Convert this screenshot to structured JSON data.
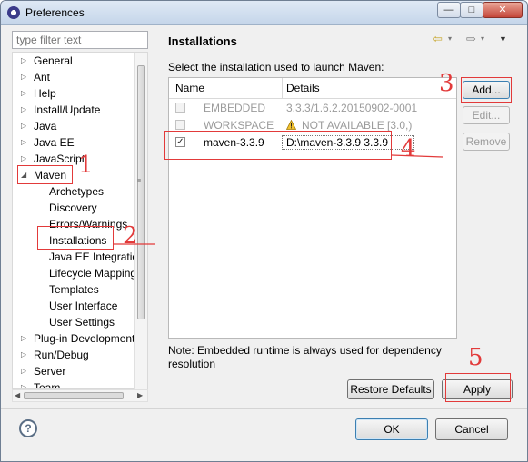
{
  "window": {
    "title": "Preferences",
    "minimize_glyph": "—",
    "maximize_glyph": "□",
    "close_glyph": "✕"
  },
  "sidebar": {
    "filter_placeholder": "type filter text",
    "items": [
      {
        "label": "General",
        "expander": "▷"
      },
      {
        "label": "Ant",
        "expander": "▷"
      },
      {
        "label": "Help",
        "expander": "▷"
      },
      {
        "label": "Install/Update",
        "expander": "▷"
      },
      {
        "label": "Java",
        "expander": "▷"
      },
      {
        "label": "Java EE",
        "expander": "▷"
      },
      {
        "label": "JavaScript",
        "expander": "▷"
      },
      {
        "label": "Maven",
        "expander": "◢"
      },
      {
        "label": "Archetypes"
      },
      {
        "label": "Discovery"
      },
      {
        "label": "Errors/Warnings"
      },
      {
        "label": "Installations"
      },
      {
        "label": "Java EE Integration"
      },
      {
        "label": "Lifecycle Mapping"
      },
      {
        "label": "Templates"
      },
      {
        "label": "User Interface"
      },
      {
        "label": "User Settings"
      },
      {
        "label": "Plug-in Development",
        "expander": "▷"
      },
      {
        "label": "Run/Debug",
        "expander": "▷"
      },
      {
        "label": "Server",
        "expander": "▷"
      },
      {
        "label": "Team",
        "expander": "▷"
      }
    ],
    "scroll": {
      "left_arrow": "◀",
      "right_arrow": "▶",
      "grip": "≡"
    }
  },
  "main": {
    "title": "Installations",
    "nav": {
      "back": "⇦",
      "dropdown": "▾",
      "forward": "⇨",
      "menu": "▼"
    },
    "instruction": "Select the installation used to launch Maven:",
    "table": {
      "columns": [
        "Name",
        "Details"
      ],
      "rows": [
        {
          "checked": false,
          "enabled": false,
          "name": "EMBEDDED",
          "details": "3.3.3/1.6.2.20150902-0001"
        },
        {
          "checked": false,
          "enabled": false,
          "name": "WORKSPACE",
          "details": "NOT AVAILABLE [3.0,)"
        },
        {
          "checked": true,
          "enabled": true,
          "name": "maven-3.3.9",
          "details": "D:\\maven-3.3.9 3.3.9"
        }
      ]
    },
    "buttons": {
      "add": "Add...",
      "edit": "Edit...",
      "remove": "Remove"
    },
    "note": "Note: Embedded runtime is always used for dependency resolution",
    "restore_defaults": "Restore Defaults",
    "apply": "Apply"
  },
  "footer": {
    "help": "?",
    "ok": "OK",
    "cancel": "Cancel"
  },
  "annotations": {
    "color": "#e23a3a",
    "labels": [
      "1",
      "2",
      "3",
      "4",
      "5"
    ]
  },
  "check_glyph": "✓"
}
